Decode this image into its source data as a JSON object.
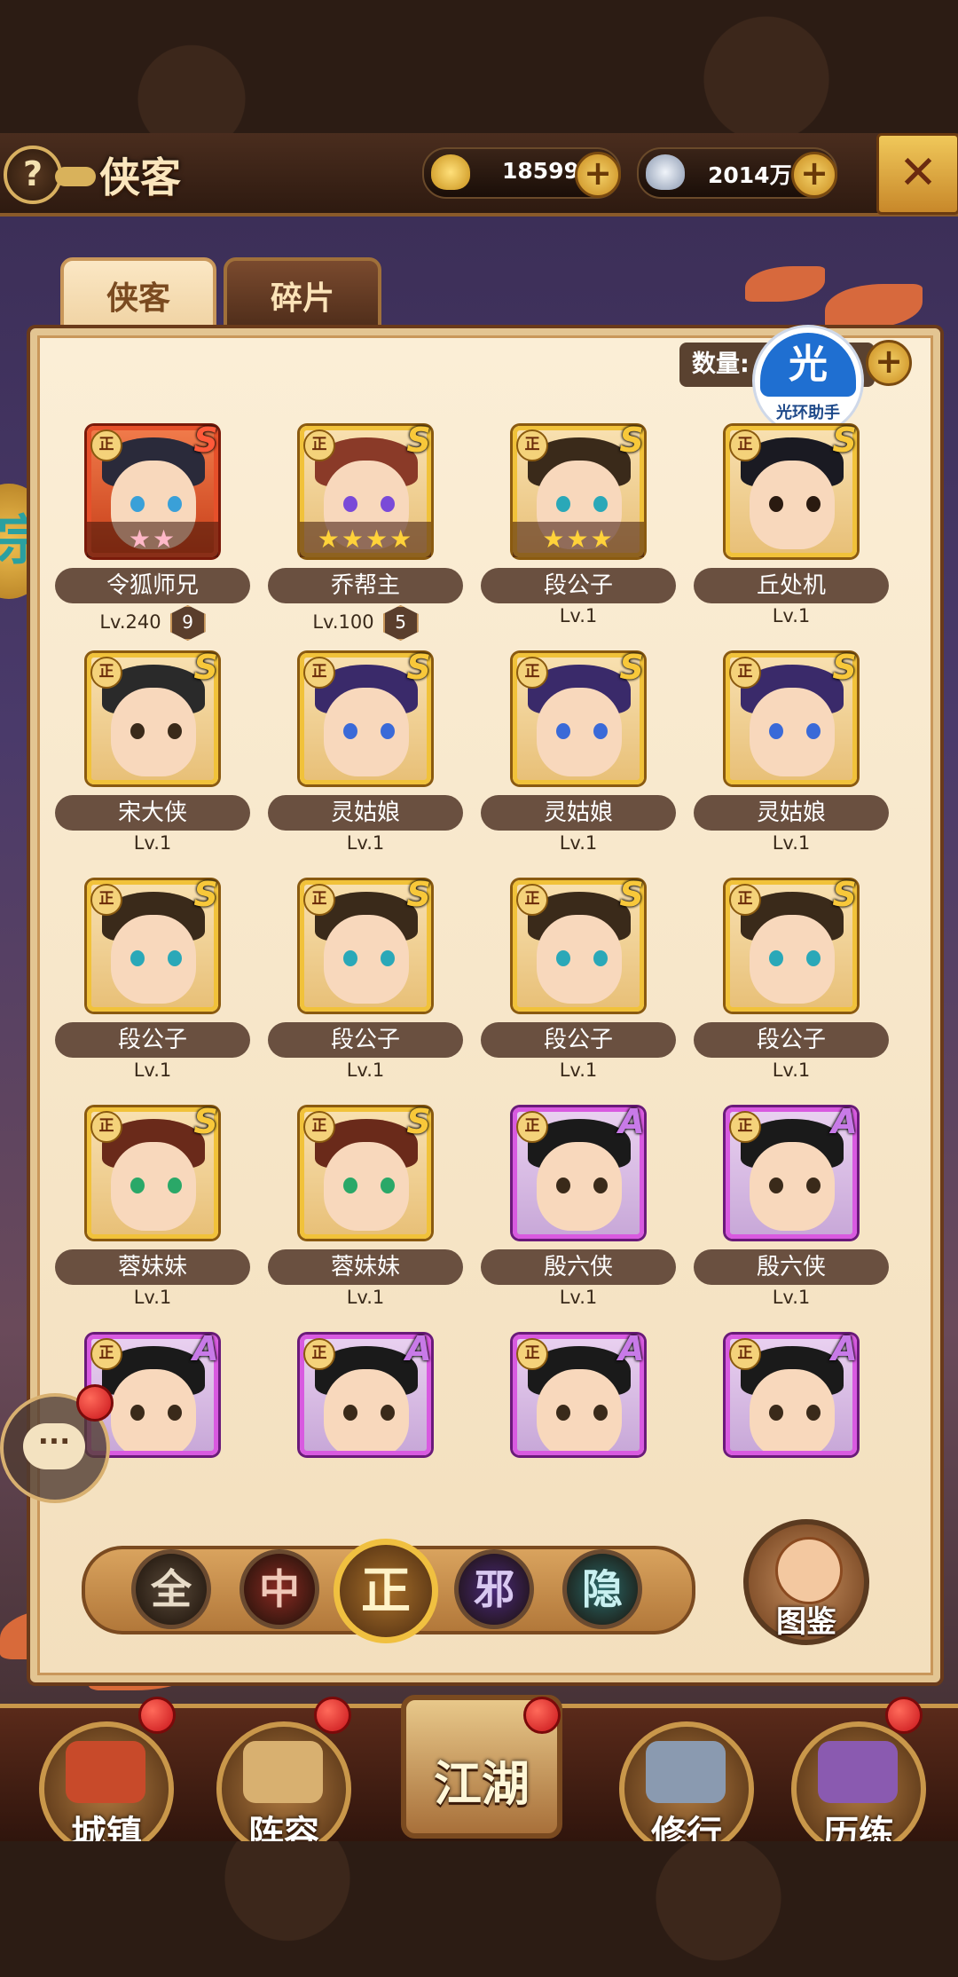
{
  "header": {
    "help_label": "?",
    "title": "侠客",
    "close_label": "✕"
  },
  "resources": [
    {
      "name": "gold-ingot",
      "value": "18599",
      "color": "#f0c040"
    },
    {
      "name": "silver-ingot",
      "value": "2014万",
      "color": "#c8d2e0"
    }
  ],
  "tabs": [
    {
      "label": "侠客",
      "active": true
    },
    {
      "label": "碎片",
      "active": false
    }
  ],
  "count": {
    "label": "数量:"
  },
  "helper": {
    "glyph": "光",
    "label": "光环助手"
  },
  "side_badge": {
    "glyph": "宗"
  },
  "heroes": [
    {
      "name": "令狐师兄",
      "level": "Lv.240",
      "extra": "9",
      "rank": "S",
      "frame": "red",
      "stars": "★★",
      "star_color": "pink",
      "hair": "#2a2a3a",
      "eyes": "#3aa0d8"
    },
    {
      "name": "乔帮主",
      "level": "Lv.100",
      "extra": "5",
      "rank": "S",
      "frame": "gold",
      "stars": "★★★★",
      "star_color": "gold",
      "hair": "#8a3a28",
      "eyes": "#7a4ad8"
    },
    {
      "name": "段公子",
      "level": "Lv.1",
      "extra": "",
      "rank": "S",
      "frame": "gold",
      "stars": "★★★",
      "star_color": "gold",
      "hair": "#3a2a1a",
      "eyes": "#2aa8b8"
    },
    {
      "name": "丘处机",
      "level": "Lv.1",
      "extra": "",
      "rank": "S",
      "frame": "gold",
      "stars": "",
      "star_color": "gold",
      "hair": "#1a1a22",
      "eyes": "#2a1a10"
    },
    {
      "name": "宋大侠",
      "level": "Lv.1",
      "extra": "",
      "rank": "S",
      "frame": "gold",
      "stars": "",
      "star_color": "gold",
      "hair": "#2a2a2a",
      "eyes": "#3a2a1a"
    },
    {
      "name": "灵姑娘",
      "level": "Lv.1",
      "extra": "",
      "rank": "S",
      "frame": "gold",
      "stars": "",
      "star_color": "gold",
      "hair": "#3a2a6a",
      "eyes": "#3a6ad8"
    },
    {
      "name": "灵姑娘",
      "level": "Lv.1",
      "extra": "",
      "rank": "S",
      "frame": "gold",
      "stars": "",
      "star_color": "gold",
      "hair": "#3a2a6a",
      "eyes": "#3a6ad8"
    },
    {
      "name": "灵姑娘",
      "level": "Lv.1",
      "extra": "",
      "rank": "S",
      "frame": "gold",
      "stars": "",
      "star_color": "gold",
      "hair": "#3a2a6a",
      "eyes": "#3a6ad8"
    },
    {
      "name": "段公子",
      "level": "Lv.1",
      "extra": "",
      "rank": "S",
      "frame": "gold",
      "stars": "",
      "star_color": "gold",
      "hair": "#3a2a1a",
      "eyes": "#2aa8b8"
    },
    {
      "name": "段公子",
      "level": "Lv.1",
      "extra": "",
      "rank": "S",
      "frame": "gold",
      "stars": "",
      "star_color": "gold",
      "hair": "#3a2a1a",
      "eyes": "#2aa8b8"
    },
    {
      "name": "段公子",
      "level": "Lv.1",
      "extra": "",
      "rank": "S",
      "frame": "gold",
      "stars": "",
      "star_color": "gold",
      "hair": "#3a2a1a",
      "eyes": "#2aa8b8"
    },
    {
      "name": "段公子",
      "level": "Lv.1",
      "extra": "",
      "rank": "S",
      "frame": "gold",
      "stars": "",
      "star_color": "gold",
      "hair": "#3a2a1a",
      "eyes": "#2aa8b8"
    },
    {
      "name": "蓉妹妹",
      "level": "Lv.1",
      "extra": "",
      "rank": "S",
      "frame": "gold",
      "stars": "",
      "star_color": "gold",
      "hair": "#6a2a1a",
      "eyes": "#2aa868"
    },
    {
      "name": "蓉妹妹",
      "level": "Lv.1",
      "extra": "",
      "rank": "S",
      "frame": "gold",
      "stars": "",
      "star_color": "gold",
      "hair": "#6a2a1a",
      "eyes": "#2aa868"
    },
    {
      "name": "殷六侠",
      "level": "Lv.1",
      "extra": "",
      "rank": "A",
      "frame": "purple",
      "stars": "",
      "star_color": "gold",
      "hair": "#1a1a1a",
      "eyes": "#3a2a1a"
    },
    {
      "name": "殷六侠",
      "level": "Lv.1",
      "extra": "",
      "rank": "A",
      "frame": "purple",
      "stars": "",
      "star_color": "gold",
      "hair": "#1a1a1a",
      "eyes": "#3a2a1a"
    },
    {
      "name": "",
      "level": "",
      "extra": "",
      "rank": "A",
      "frame": "purple",
      "stars": "",
      "star_color": "gold",
      "hair": "#1a1a1a",
      "eyes": "#3a2a1a"
    },
    {
      "name": "",
      "level": "",
      "extra": "",
      "rank": "A",
      "frame": "purple",
      "stars": "",
      "star_color": "gold",
      "hair": "#1a1a1a",
      "eyes": "#3a2a1a"
    },
    {
      "name": "",
      "level": "",
      "extra": "",
      "rank": "A",
      "frame": "purple",
      "stars": "",
      "star_color": "gold",
      "hair": "#1a1a1a",
      "eyes": "#3a2a1a"
    },
    {
      "name": "",
      "level": "",
      "extra": "",
      "rank": "A",
      "frame": "purple",
      "stars": "",
      "star_color": "gold",
      "hair": "#1a1a1a",
      "eyes": "#3a2a1a"
    }
  ],
  "hero_badge": "正",
  "filters": [
    {
      "label": "全",
      "color": "#5a4a3a",
      "text": "#e8dcc8"
    },
    {
      "label": "中",
      "color": "#8a2a22",
      "text": "#f0c8b8"
    },
    {
      "label": "正",
      "color": "#c8882a",
      "text": "#fff3c8",
      "active": true
    },
    {
      "label": "邪",
      "color": "#4a2a7a",
      "text": "#d8c8f0"
    },
    {
      "label": "隐",
      "color": "#2a6a6a",
      "text": "#c8f0f0"
    }
  ],
  "codex": {
    "label": "图鉴"
  },
  "chat": {
    "glyph": "···"
  },
  "nav": [
    {
      "label": "城镇",
      "art_color": "#c84a2a"
    },
    {
      "label": "阵容",
      "art_color": "#d8b070"
    },
    {
      "label": "江湖",
      "art_color": "#c8a060"
    },
    {
      "label": "修行",
      "art_color": "#8a9ab0"
    },
    {
      "label": "历练",
      "art_color": "#8a5ab0"
    }
  ]
}
